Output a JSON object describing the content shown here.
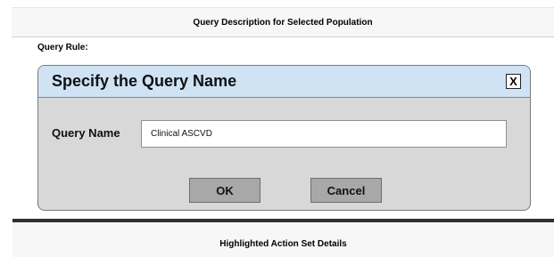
{
  "top_panel": {
    "title": "Query Description for Selected Population",
    "query_rule_label": "Query Rule:"
  },
  "dialog": {
    "title": "Specify the Query Name",
    "close_label": "X",
    "field_label": "Query Name",
    "field_value": "Clinical ASCVD",
    "ok_label": "OK",
    "cancel_label": "Cancel"
  },
  "bottom_panel": {
    "title": "Highlighted Action Set Details"
  },
  "colors": {
    "dialog_titlebar": "#cfe3f5",
    "dialog_body": "#d8d8d8",
    "button_fill": "#a8a8a8"
  }
}
